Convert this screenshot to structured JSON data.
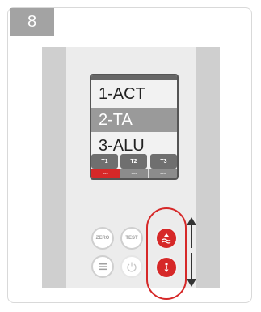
{
  "step": {
    "number": "8"
  },
  "display": {
    "menu": [
      "1-ACT",
      "2-TA",
      "3-ALU"
    ],
    "selected_index": 1,
    "softkeys": [
      "---",
      "---",
      "---"
    ]
  },
  "keypad": {
    "t_keys": [
      "T1",
      "T2",
      "T3"
    ],
    "zero_label": "ZERO",
    "test_label": "TEST"
  },
  "colors": {
    "accent": "#d62828",
    "badge": "#a3a3a3"
  },
  "icons": [
    "menu-icon",
    "power-icon",
    "boat-up-icon",
    "diver-down-icon",
    "arrow-up-icon",
    "arrow-down-icon"
  ]
}
